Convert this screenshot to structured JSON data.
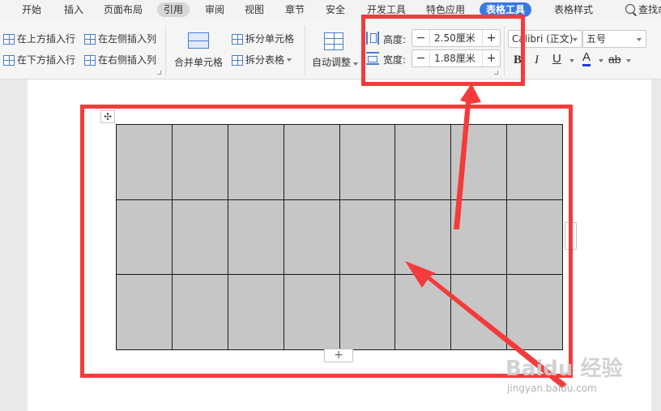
{
  "menu": {
    "items": [
      "开始",
      "插入",
      "页面布局",
      "引用",
      "审阅",
      "视图",
      "章节",
      "安全",
      "开发工具",
      "特色应用",
      "表格工具",
      "表格样式"
    ],
    "search_label": "查找命"
  },
  "ribbon": {
    "insert_above": "在上方插入行",
    "insert_below": "在下方插入行",
    "insert_left": "在左侧插入列",
    "insert_right": "在右侧插入列",
    "merge_cells": "合并单元格",
    "split_cells": "拆分单元格",
    "split_table": "拆分表格",
    "auto_fit": "自动调整",
    "height_label": "高度:",
    "height_value": "2.50厘米",
    "width_label": "宽度:",
    "width_value": "1.88厘米",
    "minus": "−",
    "plus": "+",
    "font_name": "Calibri (正文)",
    "font_size": "五号",
    "bold": "B",
    "italic": "I",
    "underline": "U",
    "font_color": "A",
    "highlight": "ab"
  },
  "table": {
    "rows": 3,
    "cols": 8
  },
  "document": {
    "move_handle": "✣",
    "add_row": "+"
  },
  "watermark": {
    "main": "Baidu 经验",
    "sub": "jingyan.baidu.com"
  },
  "colors": {
    "accent": "#3a78e8",
    "annotation": "#f43b3b",
    "cell_fill": "#c6c6c6"
  }
}
